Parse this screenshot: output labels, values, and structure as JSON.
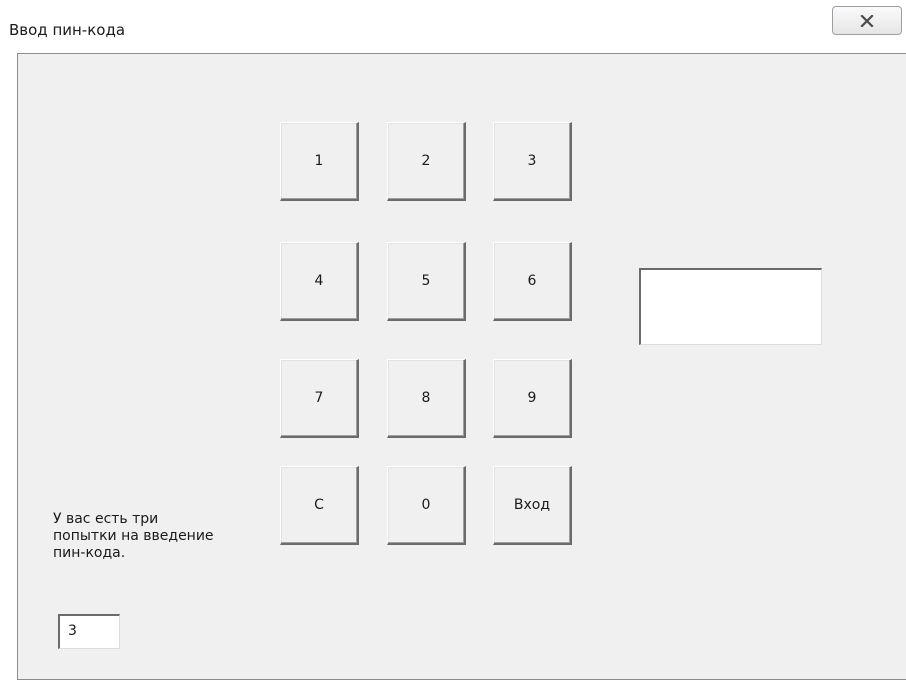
{
  "window": {
    "title": "Ввод пин-кода",
    "close_icon": "close-icon"
  },
  "keypad": {
    "keys": [
      "1",
      "2",
      "3",
      "4",
      "5",
      "6",
      "7",
      "8",
      "9",
      "C",
      "0",
      "Вход"
    ]
  },
  "pin_display": {
    "value": ""
  },
  "info": {
    "text": "У вас есть три\nпопытки на введение\nпин-кода."
  },
  "attempts": {
    "value": "3"
  }
}
